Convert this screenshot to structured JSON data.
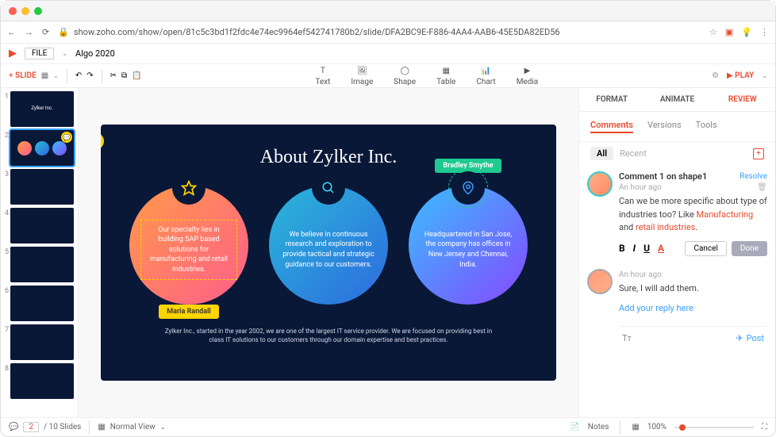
{
  "url": "show.zoho.com/show/open/81c5c3bd1f2fdc4e74ec9964ef542741780b2/slide/DFA2BC9E-F886-4AA4-AAB6-45E5DA82ED56",
  "doc_title": "Algo 2020",
  "file_label": "FILE",
  "toolbar": {
    "slide_add": "SLIDE",
    "mid_items": [
      "Text",
      "Image",
      "Shape",
      "Table",
      "Chart",
      "Media"
    ],
    "play": "PLAY"
  },
  "panel": {
    "tabs": [
      "FORMAT",
      "ANIMATE",
      "REVIEW"
    ],
    "subtabs": [
      "Comments",
      "Versions",
      "Tools"
    ],
    "filter_all": "All",
    "filter_recent": "Recent",
    "comment1": {
      "title": "Comment 1 on shape1",
      "resolve": "Resolve",
      "time": "An hour ago",
      "text_pre": "Can we be more specific about type of industries too? Like ",
      "hl1": "Manufacturing",
      "mid": " and ",
      "hl2": "retail industries",
      "dot": ".",
      "cancel": "Cancel",
      "done": "Done"
    },
    "comment2": {
      "time": "An hour ago",
      "text": "Sure, I will add them."
    },
    "reply_placeholder": "Add your reply here",
    "post": "Post"
  },
  "slide": {
    "title": "About Zylker Inc.",
    "c1": "Our specialty lies in building SAP based solutions for manufacturing and retail Industries.",
    "c2": "We believe in continuous research and exploration to provide tactical and strategic guidance to our customers.",
    "c3": "Headquartered in San Jose, the company has offices in New Jersey and Chennai, India.",
    "tag1": "Maria Randall",
    "tag2": "Bradley Smythe",
    "footer": "Zylker Inc., started in the year 2002, we are one of the largest IT service provider. We are focused on providing best in class IT solutions to our customers through our domain expertise and best practices."
  },
  "status": {
    "page": "2",
    "total": "/ 10 Slides",
    "view": "Normal View",
    "notes": "Notes",
    "zoom": "100%"
  }
}
